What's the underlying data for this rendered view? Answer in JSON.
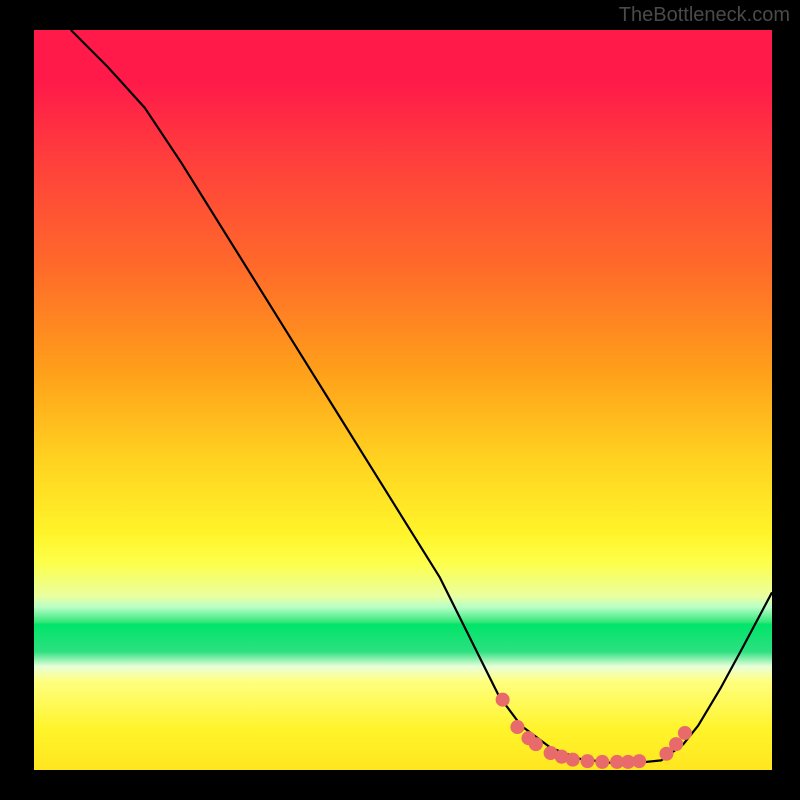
{
  "attribution": "TheBottleneck.com",
  "chart_data": {
    "type": "line",
    "title": "",
    "xlabel": "",
    "ylabel": "",
    "xlim": [
      0,
      100
    ],
    "ylim": [
      0,
      100
    ],
    "series": [
      {
        "name": "curve",
        "x": [
          5,
          10,
          15,
          20,
          25,
          30,
          35,
          40,
          45,
          50,
          55,
          60,
          63,
          66,
          70,
          74,
          78,
          82,
          85,
          88,
          90,
          93,
          96,
          100
        ],
        "values": [
          100,
          95,
          89.5,
          82,
          74,
          66,
          58,
          50,
          42,
          34,
          26,
          16,
          10,
          6,
          3,
          1.5,
          1,
          1,
          1.3,
          3.5,
          6,
          11,
          16.5,
          24
        ]
      },
      {
        "name": "markers",
        "x": [
          63.5,
          65.5,
          67,
          68,
          70,
          71.5,
          73,
          75,
          77,
          79,
          80.5,
          82,
          85.7,
          87,
          88.2
        ],
        "values": [
          9.5,
          5.8,
          4.3,
          3.5,
          2.3,
          1.8,
          1.4,
          1.2,
          1.1,
          1.1,
          1.1,
          1.2,
          2.2,
          3.5,
          5.0
        ]
      }
    ]
  }
}
